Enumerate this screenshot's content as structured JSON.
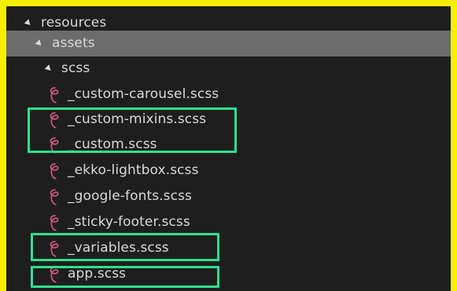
{
  "explorer": {
    "folders": [
      {
        "label": "resources",
        "expanded": true
      },
      {
        "label": "assets",
        "expanded": true,
        "selected": true
      },
      {
        "label": "scss",
        "expanded": true
      }
    ],
    "files": [
      {
        "label": "_custom-carousel.scss",
        "icon": "sass-icon"
      },
      {
        "label": "_custom-mixins.scss",
        "icon": "sass-icon"
      },
      {
        "label": "_custom.scss",
        "icon": "sass-icon"
      },
      {
        "label": "_ekko-lightbox.scss",
        "icon": "sass-icon"
      },
      {
        "label": "_google-fonts.scss",
        "icon": "sass-icon"
      },
      {
        "label": "_sticky-footer.scss",
        "icon": "sass-icon"
      },
      {
        "label": "_variables.scss",
        "icon": "sass-icon"
      },
      {
        "label": "app.scss",
        "icon": "sass-icon"
      }
    ]
  },
  "colors": {
    "frame": "#f6ef00",
    "background": "#1e1e1e",
    "selected_row": "#6c6c6c",
    "text": "#d9d9d9",
    "sass_icon": "#c8577e",
    "highlight_box": "#2ee090"
  }
}
